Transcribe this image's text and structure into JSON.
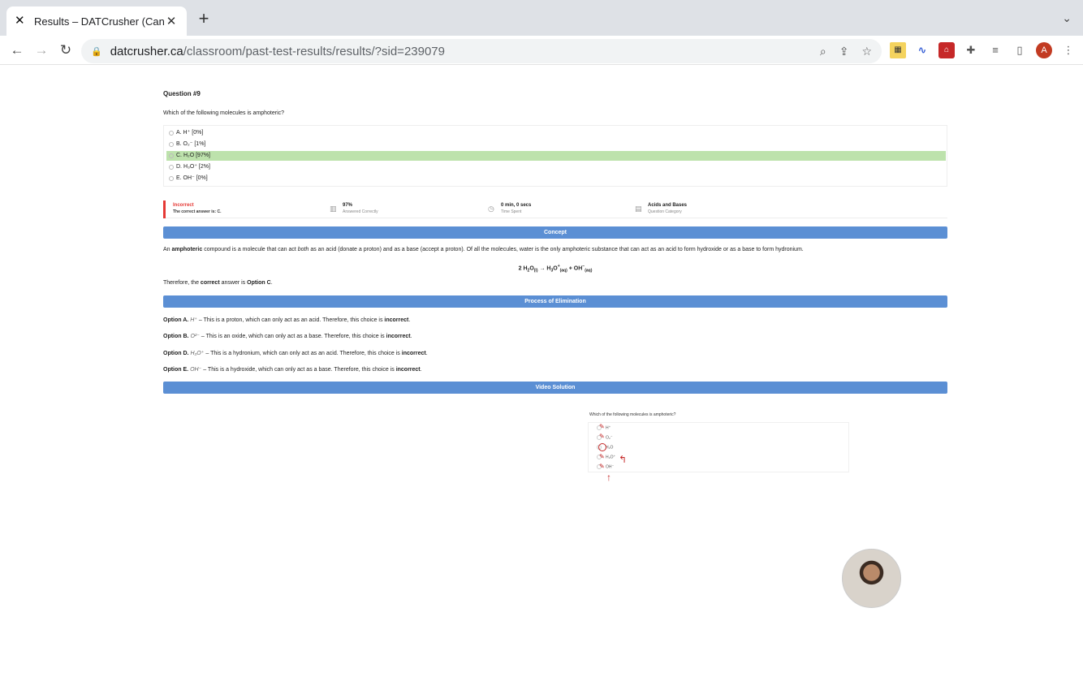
{
  "browser": {
    "tab_title": "Results – DATCrusher (Canadia",
    "url_host": "datcrusher.ca",
    "url_path": "/classroom/past-test-results/results/?sid=239079",
    "avatar_letter": "A"
  },
  "question": {
    "number": "Question #9",
    "text": "Which of the following molecules is amphoteric?",
    "options": [
      {
        "label": "A. H⁺ [0%]"
      },
      {
        "label": "B. O₂⁻ [1%]"
      },
      {
        "label": "C. H₂O [97%]"
      },
      {
        "label": "D. H₃O⁺ [2%]"
      },
      {
        "label": "E. OH⁻ [0%]"
      }
    ],
    "correct_index": 2
  },
  "stats": {
    "result": "Incorrect",
    "correct_answer": "The correct answer is: C.",
    "percent": "97%",
    "percent_label": "Answered Correctly",
    "time": "0 min, 0 secs",
    "time_label": "Time Spent",
    "category": "Acids and Bases",
    "category_label": "Question Category"
  },
  "concept": {
    "heading": "Concept",
    "p1_a": "An ",
    "p1_b": "amphoteric",
    "p1_c": " compound is a molecule that can act ",
    "p1_d": "both",
    "p1_e": " as an acid (donate a proton) and as a base (accept a proton). Of all the molecules, water is the only amphoteric substance that can act as an acid to form hydroxide or as a base to form hydronium.",
    "therefore_a": "Therefore, the ",
    "therefore_b": "correct",
    "therefore_c": " answer is ",
    "therefore_d": "Option C",
    "therefore_e": "."
  },
  "elimination": {
    "heading": "Process of Elimination",
    "items": [
      {
        "opt": "Option A.",
        "sym": "H⁺",
        "text": " – This is a proton, which can only act as an acid. Therefore, this choice is ",
        "verdict": "incorrect",
        "end": "."
      },
      {
        "opt": "Option B.",
        "sym": "O²⁻",
        "text": " – This is an oxide, which can only act as a base. Therefore, this choice is ",
        "verdict": "incorrect",
        "end": "."
      },
      {
        "opt": "Option D.",
        "sym": "H₃O⁺",
        "text": " – This is a hydronium, which can only act as an acid. Therefore, this choice is ",
        "verdict": "incorrect",
        "end": "."
      },
      {
        "opt": "Option E.",
        "sym": "OH⁻",
        "text": " – This is a hydroxide, which can only act as a base. Therefore, this choice is ",
        "verdict": "incorrect",
        "end": "."
      }
    ]
  },
  "video": {
    "heading": "Video Solution",
    "question": "Which of the following molecules is amphoteric?",
    "options": [
      "H⁺",
      "O₂⁻",
      "H₂O",
      "H₃O⁺",
      "OH⁻"
    ]
  }
}
